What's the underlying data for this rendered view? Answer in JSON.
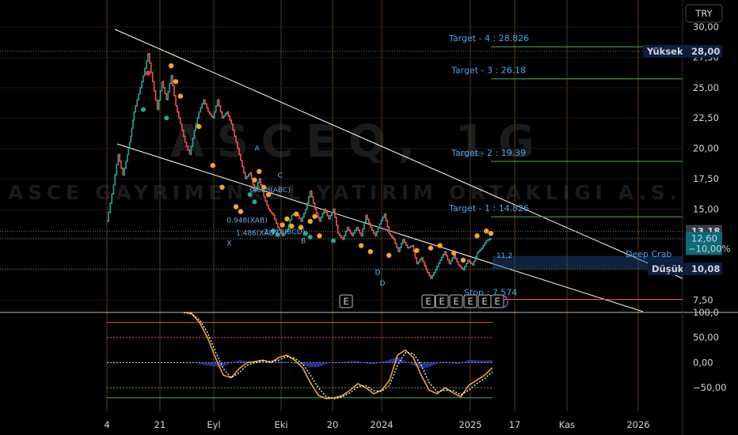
{
  "currency_button": "TRY",
  "watermark": {
    "symbol": "ASCEQ, 1G",
    "name": "ASCE GAYRIMENKUL YATIRIM ORTAKLIGI A.S."
  },
  "colors": {
    "up": "#26a69a",
    "down": "#ef5350",
    "target": "#4aa3f0",
    "marker": "#f5a623",
    "channel": "#ffffff",
    "stop": "#ef5350",
    "target_line": "#4caf50"
  },
  "chart_data": [
    {
      "type": "line",
      "title": "",
      "style": "step",
      "x": [
        "2023-07-04",
        "2023-07-14",
        "2023-07-21",
        "2023-07-28",
        "2023-08-04",
        "2023-08-09",
        "2023-08-14",
        "2023-08-21",
        "2023-08-28",
        "2023-09-04",
        "2023-09-11",
        "2023-09-18",
        "2023-09-25",
        "2023-10-02",
        "2023-10-09",
        "2023-10-16",
        "2023-10-23",
        "2023-10-30",
        "2023-11-06",
        "2023-11-13",
        "2023-11-20",
        "2023-11-27",
        "2023-12-04",
        "2023-12-11",
        "2023-12-18",
        "2023-12-25",
        "2024-01-01",
        "2024-01-08",
        "2024-01-15",
        "2024-01-22",
        "2024-01-29",
        "2024-02-05",
        "2024-02-12",
        "2024-02-19",
        "2024-02-26",
        "2024-03-04",
        "2024-03-11",
        "2024-03-18",
        "2024-03-25",
        "2024-04-01",
        "2024-04-08",
        "2024-04-15",
        "2024-04-22",
        "2024-04-29",
        "2024-05-06",
        "2024-05-13",
        "2024-05-20",
        "2024-05-27",
        "2024-06-03",
        "2024-06-10",
        "2024-06-17",
        "2024-06-24",
        "2024-07-01",
        "2024-07-08",
        "2024-07-15",
        "2024-07-22",
        "2024-07-29",
        "2024-08-05",
        "2024-08-12",
        "2024-08-19",
        "2024-08-26",
        "2024-09-02",
        "2024-09-09",
        "2024-09-16",
        "2024-09-23",
        "2024-09-30",
        "2024-10-07",
        "2024-10-14",
        "2024-10-21",
        "2024-10-28",
        "2024-11-04",
        "2024-11-11",
        "2024-11-18",
        "2024-11-25",
        "2024-12-02",
        "2024-12-09",
        "2024-12-16",
        "2024-12-23",
        "2024-12-30",
        "2025-01-06",
        "2025-01-13",
        "2025-01-20",
        "2025-01-27",
        "2025-02-03"
      ],
      "values": [
        14.0,
        17.0,
        19.5,
        17.8,
        19.5,
        21.0,
        23.0,
        24.5,
        26.0,
        27.8,
        25.5,
        23.2,
        25.5,
        24.0,
        26.0,
        23.5,
        22.0,
        20.5,
        19.5,
        21.5,
        23.0,
        24.0,
        23.0,
        22.5,
        24.0,
        22.5,
        23.0,
        22.0,
        20.5,
        19.0,
        17.5,
        18.0,
        16.5,
        17.5,
        16.0,
        15.0,
        14.5,
        13.5,
        12.8,
        13.3,
        14.5,
        14.7,
        14.0,
        15.0,
        16.5,
        15.0,
        14.0,
        15.0,
        14.2,
        15.0,
        13.0,
        12.5,
        13.5,
        12.8,
        13.5,
        12.8,
        14.5,
        13.5,
        12.8,
        13.8,
        14.6,
        13.0,
        12.5,
        11.5,
        12.5,
        11.8,
        12.0,
        10.5,
        11.0,
        10.0,
        9.3,
        10.0,
        10.8,
        11.5,
        10.5,
        11.2,
        10.4,
        10.0,
        10.8,
        10.4,
        11.4,
        11.8,
        12.4,
        12.6
      ],
      "ylim": [
        6.5,
        31.5
      ],
      "y_ticks": [
        "30,00",
        "27,50",
        "25,00",
        "22,50",
        "20,00",
        "17,50",
        "15,00",
        "12,50",
        "10,00",
        "7,50"
      ],
      "x_ticks": [
        "4",
        "21",
        "Eyl",
        "Eki",
        "20",
        "2024",
        "2025",
        "17",
        "Kas",
        "2026"
      ],
      "annotations": {
        "targets": [
          {
            "label": "Target - 4 : 28.826",
            "value": 28.826
          },
          {
            "label": "Target - 3 : 26.18",
            "value": 26.18
          },
          {
            "label": "Target - 2 : 19.39",
            "value": 19.39
          },
          {
            "label": "Target - 1 : 14.826",
            "value": 14.826
          }
        ],
        "stop": {
          "label": "Stop : 7.574",
          "value": 7.574
        },
        "pattern": "Deep Crab",
        "wave_labels": [
          "A",
          "C",
          "X",
          "B",
          "D",
          "D"
        ],
        "ratio_labels": [
          "0.618(ABC)",
          "0.948(XAB)",
          "1.486(XAD)",
          "2.618(BCD)"
        ],
        "tiny_level": "11,2",
        "event_badge": "E"
      },
      "price_tags": [
        {
          "label": "Yüksek",
          "value": "28,00"
        },
        {
          "label": "",
          "value": "13,18"
        },
        {
          "label": "",
          "value": "12,60",
          "change": "−10,00%"
        },
        {
          "label": "Düşük",
          "value": "10,08"
        }
      ]
    },
    {
      "type": "line",
      "title": "",
      "ylim": [
        -78,
        100
      ],
      "y_ticks": [
        "100,0",
        "50,00",
        "0,00",
        "−50,00"
      ],
      "levels": [
        80,
        50,
        0,
        -50,
        -70
      ],
      "series": [
        {
          "values": [
            100,
            98,
            80,
            50,
            10,
            -25,
            -30,
            -12,
            0,
            2,
            5,
            0,
            10,
            15,
            5,
            -10,
            -40,
            -65,
            -72,
            -70,
            -66,
            -55,
            -42,
            -50,
            -62,
            -55,
            -35,
            15,
            25,
            10,
            -25,
            -55,
            -62,
            -50,
            -60,
            -68,
            -45,
            -35,
            -25,
            -10
          ]
        },
        {
          "values": [
            100,
            97,
            85,
            60,
            22,
            -12,
            -30,
            -20,
            -5,
            0,
            3,
            2,
            5,
            12,
            9,
            -2,
            -25,
            -50,
            -68,
            -72,
            -68,
            -60,
            -48,
            -46,
            -56,
            -57,
            -45,
            -5,
            20,
            18,
            -5,
            -40,
            -58,
            -55,
            -56,
            -64,
            -55,
            -42,
            -32,
            -18
          ]
        }
      ]
    }
  ]
}
